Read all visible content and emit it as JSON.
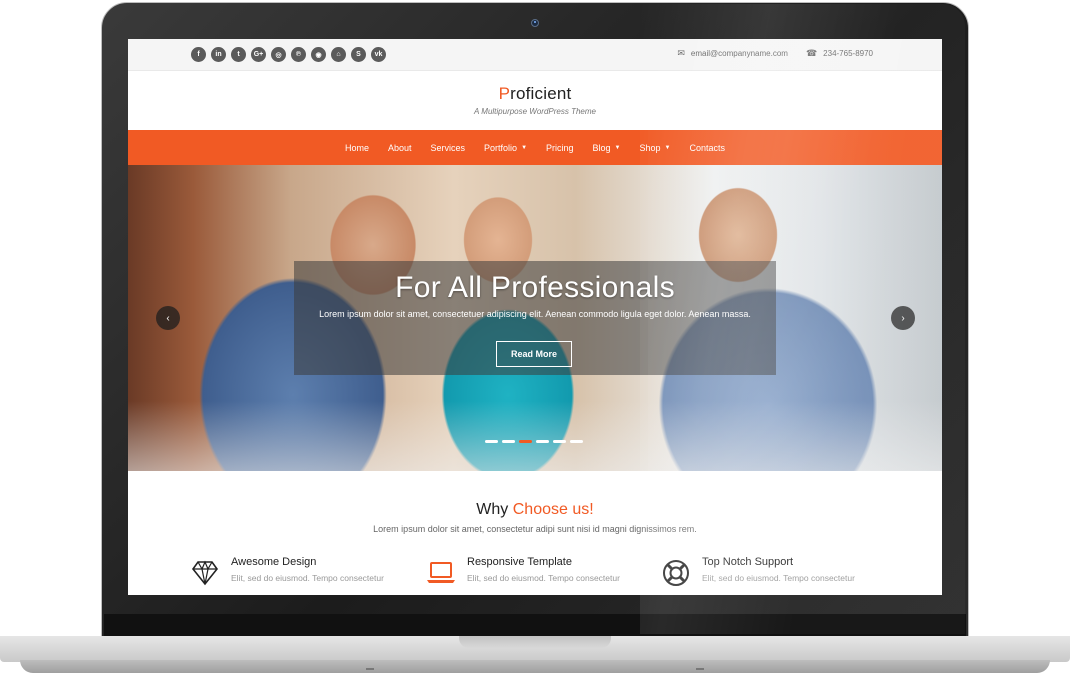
{
  "topbar": {
    "socials": [
      {
        "icon": "facebook-icon",
        "glyph": "f"
      },
      {
        "icon": "linkedin-icon",
        "glyph": "in"
      },
      {
        "icon": "twitter-icon",
        "glyph": "t"
      },
      {
        "icon": "google-plus-icon",
        "glyph": "G+"
      },
      {
        "icon": "instagram-icon",
        "glyph": "◎"
      },
      {
        "icon": "pinterest-icon",
        "glyph": "℗"
      },
      {
        "icon": "github-icon",
        "glyph": "◉"
      },
      {
        "icon": "foursquare-icon",
        "glyph": "⌂"
      },
      {
        "icon": "skype-icon",
        "glyph": "S"
      },
      {
        "icon": "vk-icon",
        "glyph": "vk"
      }
    ],
    "email": "email@companyname.com",
    "phone": "234-765-8970"
  },
  "brand": {
    "logo_first": "P",
    "logo_rest": "roficient",
    "tagline": "A Multipurpose WordPress Theme",
    "accent_color": "#f15a24"
  },
  "nav": {
    "items": [
      {
        "label": "Home",
        "dropdown": false
      },
      {
        "label": "About",
        "dropdown": false
      },
      {
        "label": "Services",
        "dropdown": false
      },
      {
        "label": "Portfolio",
        "dropdown": true
      },
      {
        "label": "Pricing",
        "dropdown": false
      },
      {
        "label": "Blog",
        "dropdown": true
      },
      {
        "label": "Shop",
        "dropdown": true
      },
      {
        "label": "Contacts",
        "dropdown": false
      }
    ]
  },
  "hero": {
    "title": "For All Professionals",
    "text": "Lorem ipsum dolor sit amet, consectetuer adipiscing elit. Aenean commodo ligula eget dolor. Aenean massa.",
    "button_label": "Read More",
    "slide_count": 6,
    "active_slide": 3
  },
  "why": {
    "heading_plain": "Why",
    "heading_accent": "Choose us!",
    "subtitle": "Lorem ipsum dolor sit amet, consectetur adipi sunt nisi id magni dignissimos rem.",
    "features": [
      {
        "icon": "diamond-icon",
        "title": "Awesome Design",
        "desc": "Elit, sed do eiusmod. Tempo consectetur"
      },
      {
        "icon": "laptop-icon",
        "title": "Responsive Template",
        "desc": "Elit, sed do eiusmod. Tempo consectetur"
      },
      {
        "icon": "lifebuoy-icon",
        "title": "Top Notch Support",
        "desc": "Elit, sed do eiusmod. Tempo consectetur"
      }
    ]
  }
}
